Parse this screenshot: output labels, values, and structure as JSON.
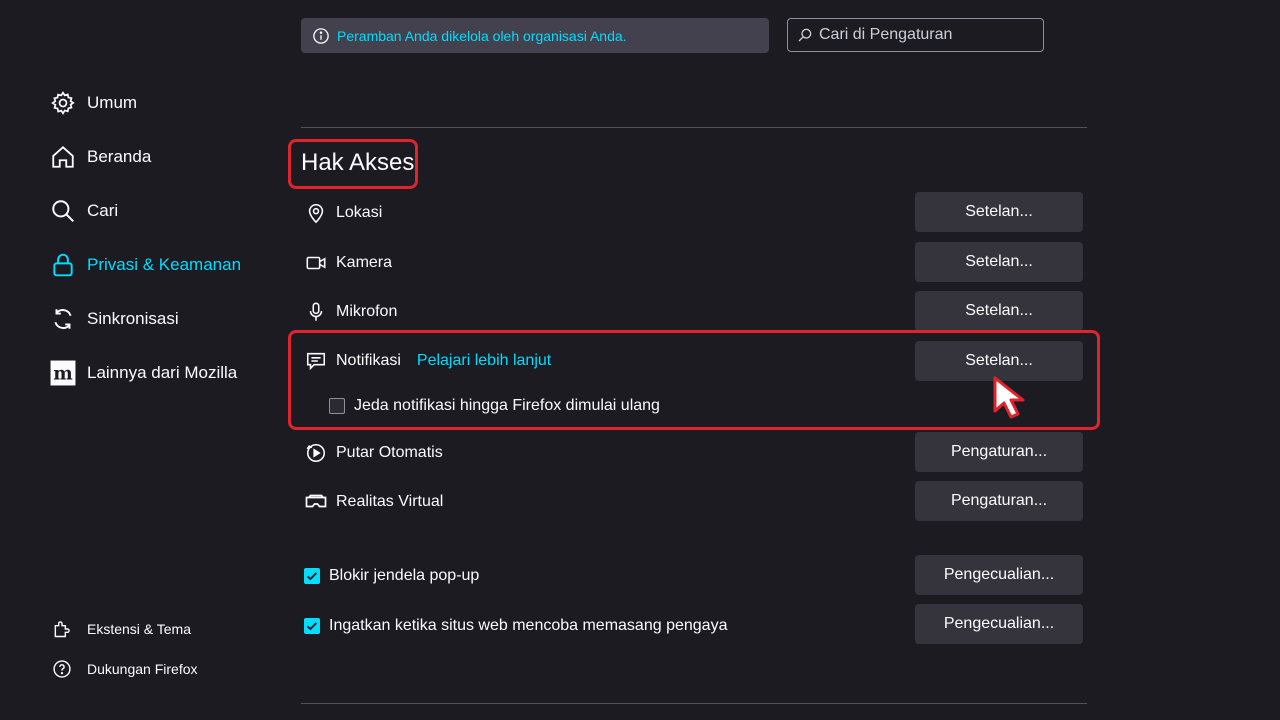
{
  "sidebar": {
    "items": [
      {
        "label": "Umum",
        "icon": "gear-icon"
      },
      {
        "label": "Beranda",
        "icon": "home-icon"
      },
      {
        "label": "Cari",
        "icon": "search-icon"
      },
      {
        "label": "Privasi & Keamanan",
        "icon": "lock-icon",
        "active": true
      },
      {
        "label": "Sinkronisasi",
        "icon": "sync-icon"
      },
      {
        "label": "Lainnya dari Mozilla",
        "icon": "mozilla-icon"
      }
    ],
    "footer": [
      {
        "label": "Ekstensi & Tema",
        "icon": "puzzle-icon"
      },
      {
        "label": "Dukungan Firefox",
        "icon": "help-icon"
      }
    ]
  },
  "managed_notice": "Peramban Anda dikelola oleh organisasi Anda.",
  "search": {
    "placeholder": "Cari di Pengaturan"
  },
  "section_title": "Hak Akses",
  "permissions": [
    {
      "label": "Lokasi",
      "icon": "location-icon",
      "button": "Setelan..."
    },
    {
      "label": "Kamera",
      "icon": "camera-icon",
      "button": "Setelan..."
    },
    {
      "label": "Mikrofon",
      "icon": "microphone-icon",
      "button": "Setelan..."
    },
    {
      "label": "Notifikasi",
      "icon": "notification-icon",
      "button": "Setelan...",
      "link": "Pelajari lebih lanjut"
    },
    {
      "label": "Putar Otomatis",
      "icon": "autoplay-icon",
      "button": "Pengaturan..."
    },
    {
      "label": "Realitas Virtual",
      "icon": "vr-icon",
      "button": "Pengaturan..."
    }
  ],
  "pause_notifications": {
    "label": "Jeda notifikasi hingga Firefox dimulai ulang",
    "checked": false
  },
  "checkbox_rows": [
    {
      "label": "Blokir jendela pop-up",
      "checked": true,
      "button": "Pengecualian..."
    },
    {
      "label": "Ingatkan ketika situs web mencoba memasang pengaya",
      "checked": true,
      "button": "Pengecualian..."
    }
  ],
  "colors": {
    "accent": "#00ddff",
    "highlight": "#e0242d",
    "background": "#1c1b22"
  }
}
